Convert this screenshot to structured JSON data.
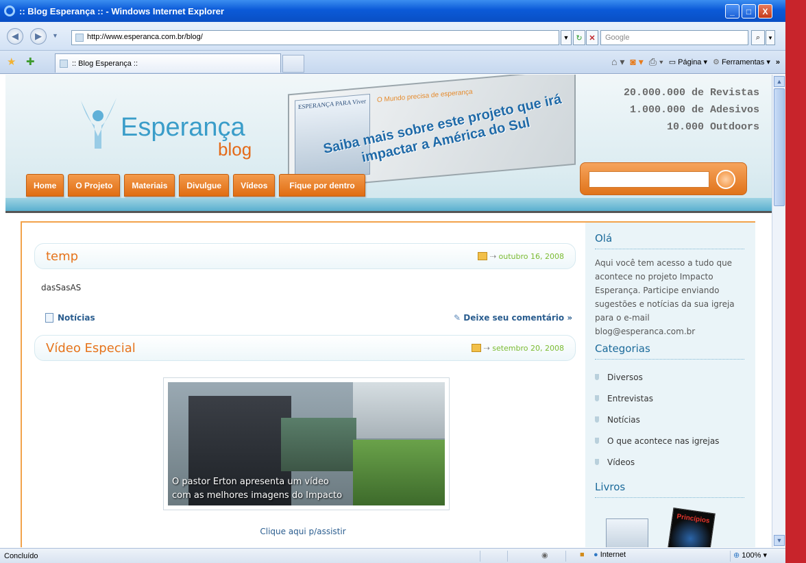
{
  "window": {
    "title": ":: Blog Esperança :: - Windows Internet Explorer",
    "min": "_",
    "max": "□",
    "close": "X"
  },
  "address": {
    "url": "http://www.esperanca.com.br/blog/",
    "search_placeholder": "Google"
  },
  "tab": {
    "label": ":: Blog Esperança ::"
  },
  "toolbar": {
    "page": "Página",
    "tools": "Ferramentas"
  },
  "header": {
    "logo_text": "Esperança",
    "logo_sub": "blog",
    "book_title": "ESPERANÇA PARA Viver",
    "billboard_mundo": "O Mundo precisa de esperança",
    "headline": "Saiba mais sobre este projeto que irá impactar a América do Sul",
    "stats": [
      "20.000.000 de Revistas",
      "1.000.000 de Adesivos",
      "10.000 Outdoors"
    ]
  },
  "nav": {
    "items": [
      "Home",
      "O Projeto",
      "Materiais",
      "Divulgue",
      "Vídeos",
      "Fique por dentro"
    ]
  },
  "posts": [
    {
      "title": "temp",
      "date": "outubro 16, 2008",
      "body": "dasSasAS",
      "category": "Notícias",
      "comment": "Deixe seu comentário »"
    },
    {
      "title": "Vídeo Especial",
      "date": "setembro 20, 2008",
      "caption_line1": "O pastor Erton apresenta um vídeo",
      "caption_line2": "com as melhores imagens do Impacto",
      "watch_link": "Clique aqui p/assistir"
    }
  ],
  "sidebar": {
    "hello_title": "Olá",
    "hello_text": "Aqui você tem acesso a tudo que acontece no projeto Impacto Esperança. Participe enviando sugestões e notícias da sua igreja para o e-mail blog@esperanca.com.br",
    "categories_title": "Categorias",
    "categories": [
      "Diversos",
      "Entrevistas",
      "Notícias",
      "O que acontece nas igrejas",
      "Vídeos"
    ],
    "books_title": "Livros",
    "book2": "Princípios"
  },
  "status": {
    "text": "Concluído",
    "zone": "Internet",
    "zoom": "100%"
  }
}
